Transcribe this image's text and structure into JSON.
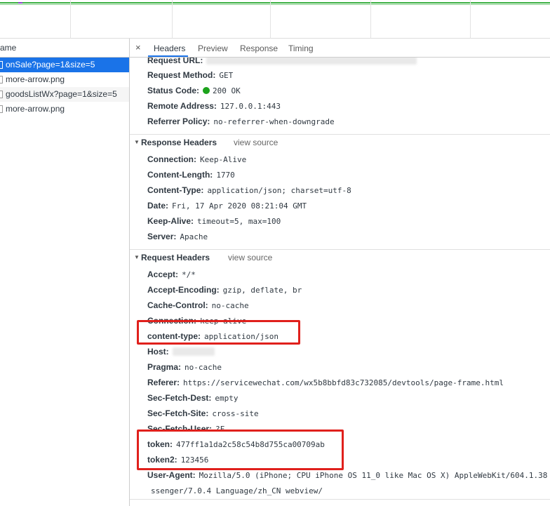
{
  "timeline": {},
  "request_list": {
    "column_header": "ame",
    "items": [
      {
        "label": "onSale?page=1&size=5",
        "selected": true
      },
      {
        "label": "more-arrow.png",
        "selected": false
      },
      {
        "label": "goodsListWx?page=1&size=5",
        "selected": false
      },
      {
        "label": "more-arrow.png",
        "selected": false
      }
    ]
  },
  "tabs": {
    "close": "×",
    "items": [
      "Headers",
      "Preview",
      "Response",
      "Timing"
    ],
    "active": "Headers"
  },
  "general": {
    "request_url": {
      "key": "Request URL:",
      "value": ""
    },
    "request_method": {
      "key": "Request Method:",
      "value": "GET"
    },
    "status_code": {
      "key": "Status Code:",
      "value": "200 OK",
      "status_color": "#1ca31c"
    },
    "remote_address": {
      "key": "Remote Address:",
      "value": "127.0.0.1:443"
    },
    "referrer_policy": {
      "key": "Referrer Policy:",
      "value": "no-referrer-when-downgrade"
    }
  },
  "response_headers": {
    "title": "Response Headers",
    "view_source": "view source",
    "rows": [
      {
        "key": "Connection:",
        "value": "Keep-Alive"
      },
      {
        "key": "Content-Length:",
        "value": "1770"
      },
      {
        "key": "Content-Type:",
        "value": "application/json; charset=utf-8"
      },
      {
        "key": "Date:",
        "value": "Fri, 17 Apr 2020 08:21:04 GMT"
      },
      {
        "key": "Keep-Alive:",
        "value": "timeout=5, max=100"
      },
      {
        "key": "Server:",
        "value": "Apache"
      }
    ]
  },
  "request_headers": {
    "title": "Request Headers",
    "view_source": "view source",
    "rows": [
      {
        "key": "Accept:",
        "value": "*/*"
      },
      {
        "key": "Accept-Encoding:",
        "value": "gzip, deflate, br"
      },
      {
        "key": "Cache-Control:",
        "value": "no-cache"
      },
      {
        "key": "Connection:",
        "value": "keep-alive"
      },
      {
        "key": "content-type:",
        "value": "application/json"
      },
      {
        "key": "Host:",
        "value": ""
      },
      {
        "key": "Pragma:",
        "value": "no-cache"
      },
      {
        "key": "Referer:",
        "value": "https://servicewechat.com/wx5b8bbfd83c732085/devtools/page-frame.html"
      },
      {
        "key": "Sec-Fetch-Dest:",
        "value": "empty"
      },
      {
        "key": "Sec-Fetch-Site:",
        "value": "cross-site"
      },
      {
        "key": "Sec-Fetch-User:",
        "value": "?F"
      },
      {
        "key": "token:",
        "value": "477ff1a1da2c58c54b8d755ca00709ab"
      },
      {
        "key": "token2:",
        "value": "123456"
      },
      {
        "key": "User-Agent:",
        "value": "Mozilla/5.0 (iPhone; CPU iPhone OS 11_0 like Mac OS X) AppleWebKit/604.1.38"
      },
      {
        "key": "",
        "value": "ssenger/7.0.4 Language/zh_CN webview/"
      }
    ]
  },
  "colors": {
    "highlight_box": "#e0201c",
    "selected_row": "#1a73e8"
  }
}
